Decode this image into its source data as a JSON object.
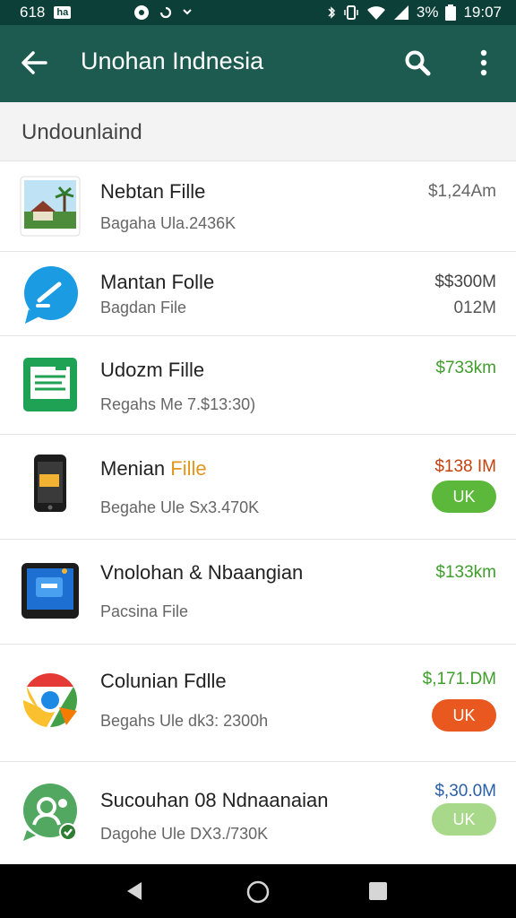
{
  "status_bar": {
    "left_text": "618",
    "left_badge": "ha",
    "battery": "3%",
    "time": "19:07"
  },
  "appbar": {
    "title": "Unohan Indnesia"
  },
  "section": {
    "header": "Undounlaind"
  },
  "items": [
    {
      "title": "Nebtan Fille",
      "title_accent": "",
      "subtitle": "Bagaha Ula.2436K",
      "price": "$1,24Am",
      "price_color": "#666666",
      "size": "",
      "pill": "",
      "pill_color": ""
    },
    {
      "title": "Mantan Folle",
      "title_accent": "",
      "subtitle": "Bagdan File",
      "price": "$$300M",
      "price_color": "#444444",
      "size": "012M",
      "pill": "",
      "pill_color": ""
    },
    {
      "title": "Udozm Fille",
      "title_accent": "",
      "subtitle": "Regahs Me 7.$13:30)",
      "price": "$733km",
      "price_color": "#3f9e2c",
      "size": "",
      "pill": "",
      "pill_color": ""
    },
    {
      "title": "Menian ",
      "title_accent": "Fille",
      "subtitle": "Begahe Ule Sx3.470K",
      "price": "$138 IM",
      "price_color": "#c2410c",
      "size": "",
      "pill": "UK",
      "pill_color": "#5cb83a"
    },
    {
      "title": "Vnolohan & Nbaangian",
      "title_accent": "",
      "subtitle": "Pacsina File",
      "price": "$133km",
      "price_color": "#3f9e2c",
      "size": "",
      "pill": "",
      "pill_color": ""
    },
    {
      "title": "Colunian Fdlle",
      "title_accent": "",
      "subtitle": "Begahs Ule dk3: 2300h",
      "price": "$,171.DM",
      "price_color": "#3f9e2c",
      "size": "",
      "pill": "UK",
      "pill_color": "#e8581f"
    },
    {
      "title": "Sucouhan 08 Ndnaanaian",
      "title_accent": "",
      "subtitle": "Dagohe Ule DX3./730K",
      "price": "$,30.0M",
      "price_color": "#2a5fa8",
      "size": "",
      "pill": "UK",
      "pill_color": "#a8d98a"
    }
  ],
  "colors": {
    "status_bar": "#0b3f37",
    "app_bar": "#1d5b50",
    "accent_green": "#5cb83a",
    "accent_orange": "#e8581f"
  }
}
